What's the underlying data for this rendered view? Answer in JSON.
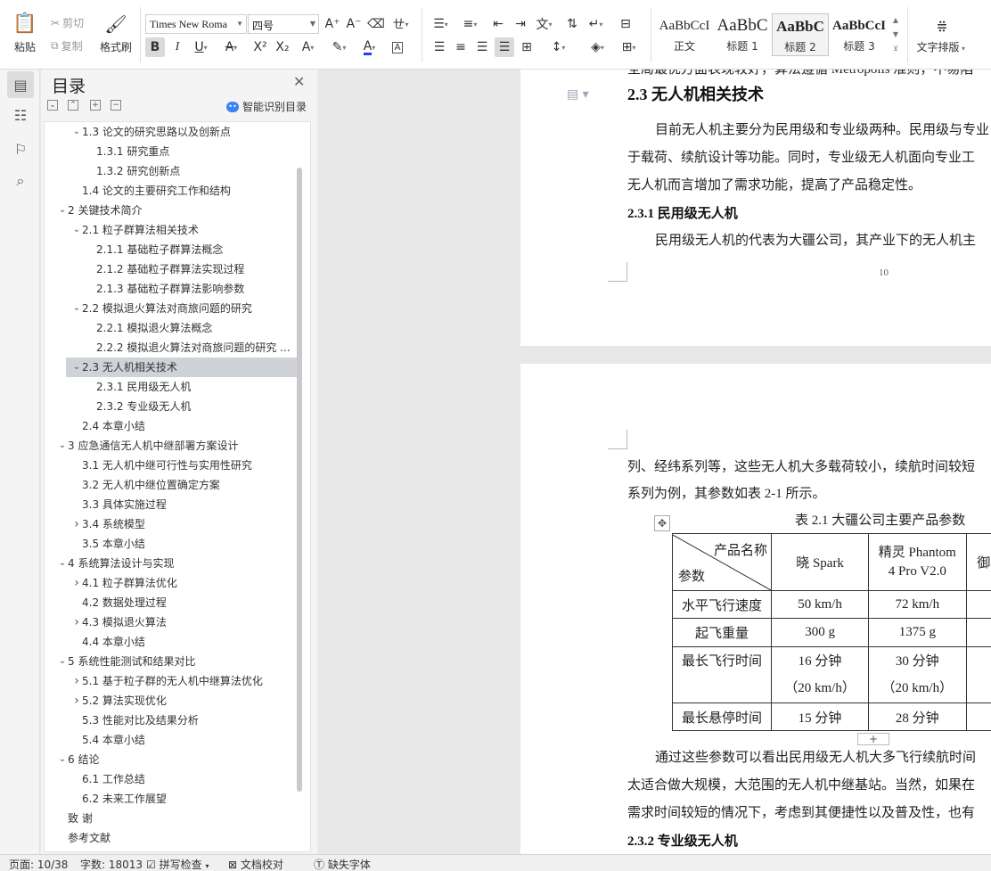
{
  "ribbon": {
    "clipboard": {
      "paste": "粘贴",
      "cut": "剪切",
      "copy": "复制",
      "format_painter": "格式刷"
    },
    "font": {
      "name": "Times New Roma",
      "size": "四号"
    },
    "styles": [
      {
        "sample": "AaBbCcI",
        "name": "正文"
      },
      {
        "sample": "AaBbC",
        "name": "标题 1"
      },
      {
        "sample": "AaBbC",
        "name": "标题 2"
      },
      {
        "sample": "AaBbCcI",
        "name": "标题 3"
      }
    ],
    "text_layout": "文字排版",
    "font_color": "#1e3dff"
  },
  "toc": {
    "title": "目录",
    "smart_label": "智能识别目录",
    "items": [
      {
        "label": "1.3 论文的研究思路以及创新点",
        "level": 1,
        "chevron": "down"
      },
      {
        "label": "1.3.1 研究重点",
        "level": 2,
        "chevron": ""
      },
      {
        "label": "1.3.2 研究创新点",
        "level": 2,
        "chevron": ""
      },
      {
        "label": "1.4 论文的主要研究工作和结构",
        "level": 1,
        "chevron": ""
      },
      {
        "label": "2 关键技术简介",
        "level": 0,
        "chevron": "down"
      },
      {
        "label": "2.1 粒子群算法相关技术",
        "level": 1,
        "chevron": "down"
      },
      {
        "label": "2.1.1 基础粒子群算法概念",
        "level": 2,
        "chevron": ""
      },
      {
        "label": "2.1.2 基础粒子群算法实现过程",
        "level": 2,
        "chevron": ""
      },
      {
        "label": "2.1.3 基础粒子群算法影响参数",
        "level": 2,
        "chevron": ""
      },
      {
        "label": "2.2 模拟退火算法对商旅问题的研究",
        "level": 1,
        "chevron": "down"
      },
      {
        "label": "2.2.1 模拟退火算法概念",
        "level": 2,
        "chevron": ""
      },
      {
        "label": "2.2.2 模拟退火算法对商旅问题的研究 ...",
        "level": 2,
        "chevron": ""
      },
      {
        "label": "2.3 无人机相关技术",
        "level": 1,
        "chevron": "down",
        "selected": true
      },
      {
        "label": "2.3.1 民用级无人机",
        "level": 2,
        "chevron": ""
      },
      {
        "label": "2.3.2 专业级无人机",
        "level": 2,
        "chevron": ""
      },
      {
        "label": "2.4 本章小结",
        "level": 1,
        "chevron": ""
      },
      {
        "label": "3 应急通信无人机中继部署方案设计",
        "level": 0,
        "chevron": "down"
      },
      {
        "label": "3.1 无人机中继可行性与实用性研究",
        "level": 1,
        "chevron": ""
      },
      {
        "label": "3.2 无人机中继位置确定方案",
        "level": 1,
        "chevron": ""
      },
      {
        "label": "3.3 具体实施过程",
        "level": 1,
        "chevron": ""
      },
      {
        "label": "3.4 系统模型",
        "level": 1,
        "chevron": "right"
      },
      {
        "label": "3.5 本章小结",
        "level": 1,
        "chevron": ""
      },
      {
        "label": "4 系统算法设计与实现",
        "level": 0,
        "chevron": "down"
      },
      {
        "label": "4.1 粒子群算法优化",
        "level": 1,
        "chevron": "right"
      },
      {
        "label": "4.2 数据处理过程",
        "level": 1,
        "chevron": ""
      },
      {
        "label": "4.3 模拟退火算法",
        "level": 1,
        "chevron": "right"
      },
      {
        "label": "4.4 本章小结",
        "level": 1,
        "chevron": ""
      },
      {
        "label": "5 系统性能测试和结果对比",
        "level": 0,
        "chevron": "down"
      },
      {
        "label": "5.1 基于粒子群的无人机中继算法优化",
        "level": 1,
        "chevron": "right"
      },
      {
        "label": "5.2 算法实现优化",
        "level": 1,
        "chevron": "right"
      },
      {
        "label": "5.3 性能对比及结果分析",
        "level": 1,
        "chevron": ""
      },
      {
        "label": "5.4 本章小结",
        "level": 1,
        "chevron": ""
      },
      {
        "label": "6 结论",
        "level": 0,
        "chevron": "down"
      },
      {
        "label": "6.1 工作总结",
        "level": 1,
        "chevron": ""
      },
      {
        "label": "6.2 未来工作展望",
        "level": 1,
        "chevron": ""
      },
      {
        "label": "致    谢",
        "level": 0,
        "chevron": ""
      },
      {
        "label": "参考文献",
        "level": 0,
        "chevron": ""
      }
    ]
  },
  "doc": {
    "page1": {
      "top_cut": "全局最优方面表现较好，算法遵循 Metropolis 准则，不易陷",
      "heading": "2.3 无人机相关技术",
      "p1": "目前无人机主要分为民用级和专业级两种。民用级与专业",
      "p2": "于载荷、续航设计等功能。同时，专业级无人机面向专业工",
      "p3": "无人机而言增加了需求功能，提高了产品稳定性。",
      "sub": "2.3.1 民用级无人机",
      "p4": "民用级无人机的代表为大疆公司，其产业下的无人机主",
      "page_number": "10"
    },
    "page2": {
      "l1": "列、经纬系列等，这些无人机大多载荷较小，续航时间较短",
      "l2": "系列为例，其参数如表 2-1 所示。",
      "caption": "表  2.1 大疆公司主要产品参数",
      "table": {
        "diag_top": "产品名称",
        "diag_bottom": "参数",
        "col1": "晓 Spark",
        "col2a": "精灵 Phantom",
        "col2b": "4 Pro V2.0",
        "col3": "御",
        "rows": [
          {
            "name": "水平飞行速度",
            "c1": "50 km/h",
            "c2": "72 km/h"
          },
          {
            "name": "起飞重量",
            "c1": "300 g",
            "c2": "1375 g"
          },
          {
            "name": "最长飞行时间",
            "c1": "16  分钟",
            "c1b": "（20 km/h）",
            "c2": "30  分钟",
            "c2b": "（20 km/h）"
          },
          {
            "name": "最长悬停时间",
            "c1": "15 分钟",
            "c2": "28 分钟"
          }
        ]
      },
      "p5": "通过这些参数可以看出民用级无人机大多飞行续航时间",
      "p6": "太适合做大规模，大范围的无人机中继基站。当然，如果在",
      "p7": "需求时间较短的情况下，考虑到其便捷性以及普及性，也有",
      "sub2": "2.3.2 专业级无人机"
    }
  },
  "status": {
    "page": "页面: 10/38",
    "words": "字数: 18013",
    "spell": "拼写检查",
    "proof": "文档校对",
    "missing_font": "缺失字体"
  }
}
